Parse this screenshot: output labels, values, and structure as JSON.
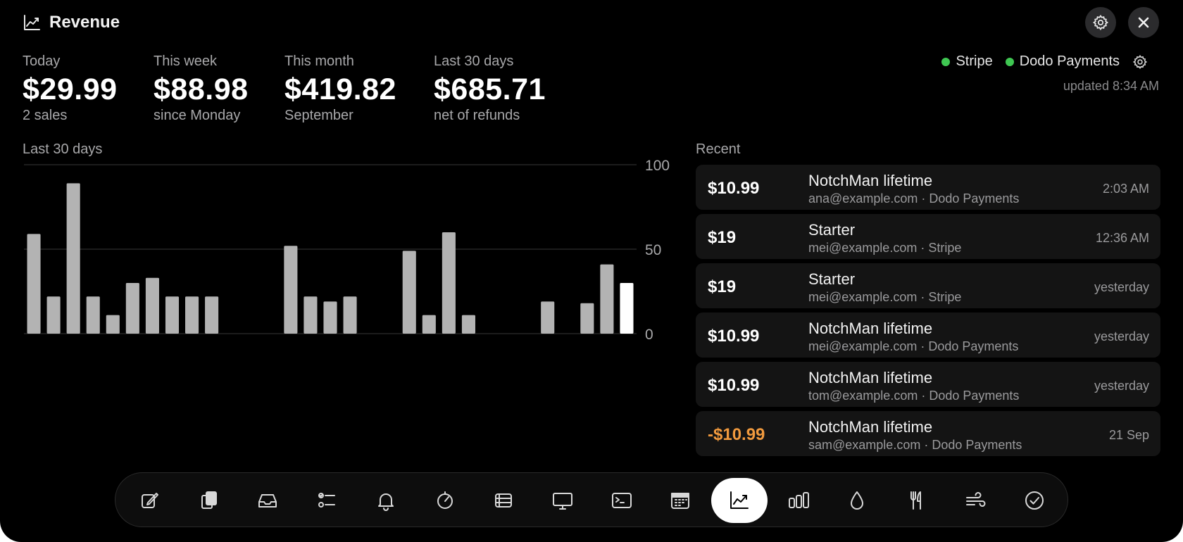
{
  "header": {
    "title": "Revenue",
    "icon": "chart-line-icon",
    "settings_icon": "gear-icon",
    "close_icon": "close-icon"
  },
  "stats": [
    {
      "label": "Today",
      "value": "$29.99",
      "sub": "2 sales"
    },
    {
      "label": "This week",
      "value": "$88.98",
      "sub": "since Monday"
    },
    {
      "label": "This month",
      "value": "$419.82",
      "sub": "September"
    },
    {
      "label": "Last 30 days",
      "value": "$685.71",
      "sub": "net of refunds"
    }
  ],
  "providers": [
    {
      "name": "Stripe",
      "status_color": "#3fc752"
    },
    {
      "name": "Dodo Payments",
      "status_color": "#3fc752"
    }
  ],
  "updated": "updated 8:34 AM",
  "chart_section": {
    "label": "Last 30 days"
  },
  "chart_data": {
    "type": "bar",
    "title": "Last 30 days",
    "values": [
      59,
      22,
      89,
      22,
      11,
      30,
      33,
      22,
      22,
      22,
      0,
      0,
      0,
      52,
      22,
      19,
      22,
      0,
      0,
      49,
      11,
      60,
      11,
      0,
      0,
      0,
      19,
      0,
      18,
      41,
      30
    ],
    "highlight_last": true,
    "ylim": [
      0,
      100
    ],
    "yticks": [
      "100",
      "50",
      "0"
    ],
    "grid": true,
    "colors": {
      "bar": "#b3b3b3",
      "highlight": "#ffffff",
      "grid": "#262626",
      "tick": "#a8a8aa"
    }
  },
  "recent": {
    "label": "Recent",
    "items": [
      {
        "amount": "$10.99",
        "product": "NotchMan lifetime",
        "meta": "ana@example.com · Dodo Payments",
        "time": "2:03 AM",
        "refund": false
      },
      {
        "amount": "$19",
        "product": "Starter",
        "meta": "mei@example.com · Stripe",
        "time": "12:36 AM",
        "refund": false
      },
      {
        "amount": "$19",
        "product": "Starter",
        "meta": "mei@example.com · Stripe",
        "time": "yesterday",
        "refund": false
      },
      {
        "amount": "$10.99",
        "product": "NotchMan lifetime",
        "meta": "mei@example.com · Dodo Payments",
        "time": "yesterday",
        "refund": false
      },
      {
        "amount": "$10.99",
        "product": "NotchMan lifetime",
        "meta": "tom@example.com · Dodo Payments",
        "time": "yesterday",
        "refund": false
      },
      {
        "amount": "-$10.99",
        "product": "NotchMan lifetime",
        "meta": "sam@example.com · Dodo Payments",
        "time": "21 Sep",
        "refund": true
      }
    ]
  },
  "dock": {
    "active_index": 10,
    "items": [
      "compose-icon",
      "clipboard-icon",
      "inbox-icon",
      "checklist-icon",
      "bell-icon",
      "timer-icon",
      "list-icon",
      "display-icon",
      "terminal-icon",
      "calendar-icon",
      "chart-line-icon",
      "bar-chart-icon",
      "drop-icon",
      "fork-knife-icon",
      "wind-icon",
      "checkmark-circle-icon"
    ]
  }
}
